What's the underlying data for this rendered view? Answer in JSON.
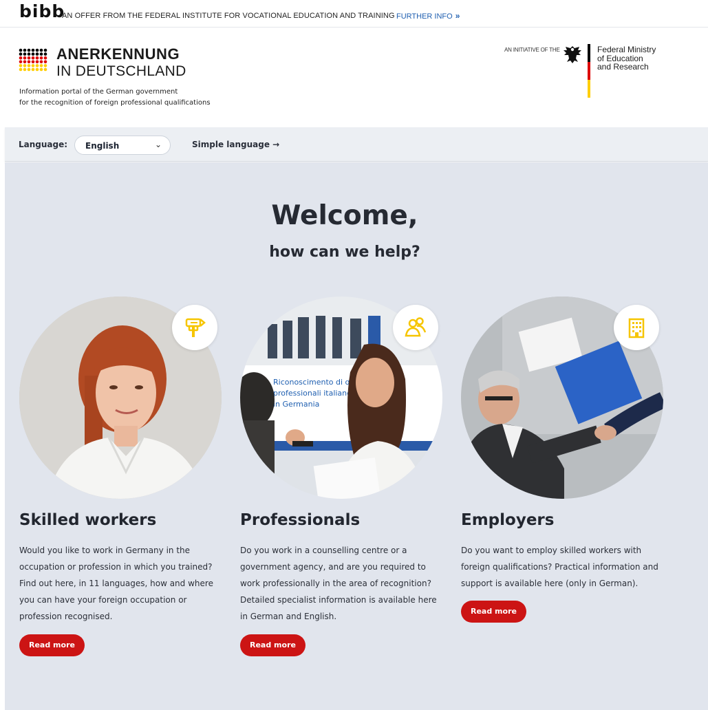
{
  "topbar": {
    "logo": "bibb",
    "offer_text": "AN OFFER FROM THE FEDERAL INSTITUTE FOR VOCATIONAL EDUCATION AND TRAINING",
    "further_info": "FURTHER INFO",
    "further_info_icon": "double-chevron-right"
  },
  "header": {
    "logo_line1": "ANERKENNUNG",
    "logo_line2": "IN DEUTSCHLAND",
    "portal_line1": "Information portal of the German government",
    "portal_line2": "for the recognition of foreign professional qualifications",
    "initiative": "AN INITIATIVE OF THE",
    "ministry_line1": "Federal Ministry",
    "ministry_line2": "of Education",
    "ministry_line3": "and Research",
    "flag_colors": [
      "#000000",
      "#dd0000",
      "#ffce00"
    ]
  },
  "langbar": {
    "label": "Language:",
    "selected": "English",
    "simple_language": "Simple language →"
  },
  "main": {
    "welcome": "Welcome,",
    "help": "how can we help?",
    "accent_yellow": "#f6c500",
    "button_red": "#cc1414",
    "cards": [
      {
        "title": "Skilled workers",
        "text": "Would you like to work in Germany in the occupation or profession in which you trained? Find out here, in 11 languages, how and where you can have your foreign occupation or profession recognised.",
        "button": "Read more",
        "icon": "signpost-icon"
      },
      {
        "title": "Professionals",
        "text": "Do you work in a counselling centre or a government agency, and are you required to work professionally in the area of recognition? Detailed specialist information is available here in German and English.",
        "button": "Read more",
        "icon": "people-icon",
        "image_sign_lines": [
          "Riconoscimento di qua",
          "professionali italiane",
          "in Germania"
        ]
      },
      {
        "title": "Employers",
        "text": "Do you want to employ skilled workers with foreign qualifications? Practical information and support is available here (only in German).",
        "button": "Read more",
        "icon": "building-icon"
      }
    ]
  }
}
